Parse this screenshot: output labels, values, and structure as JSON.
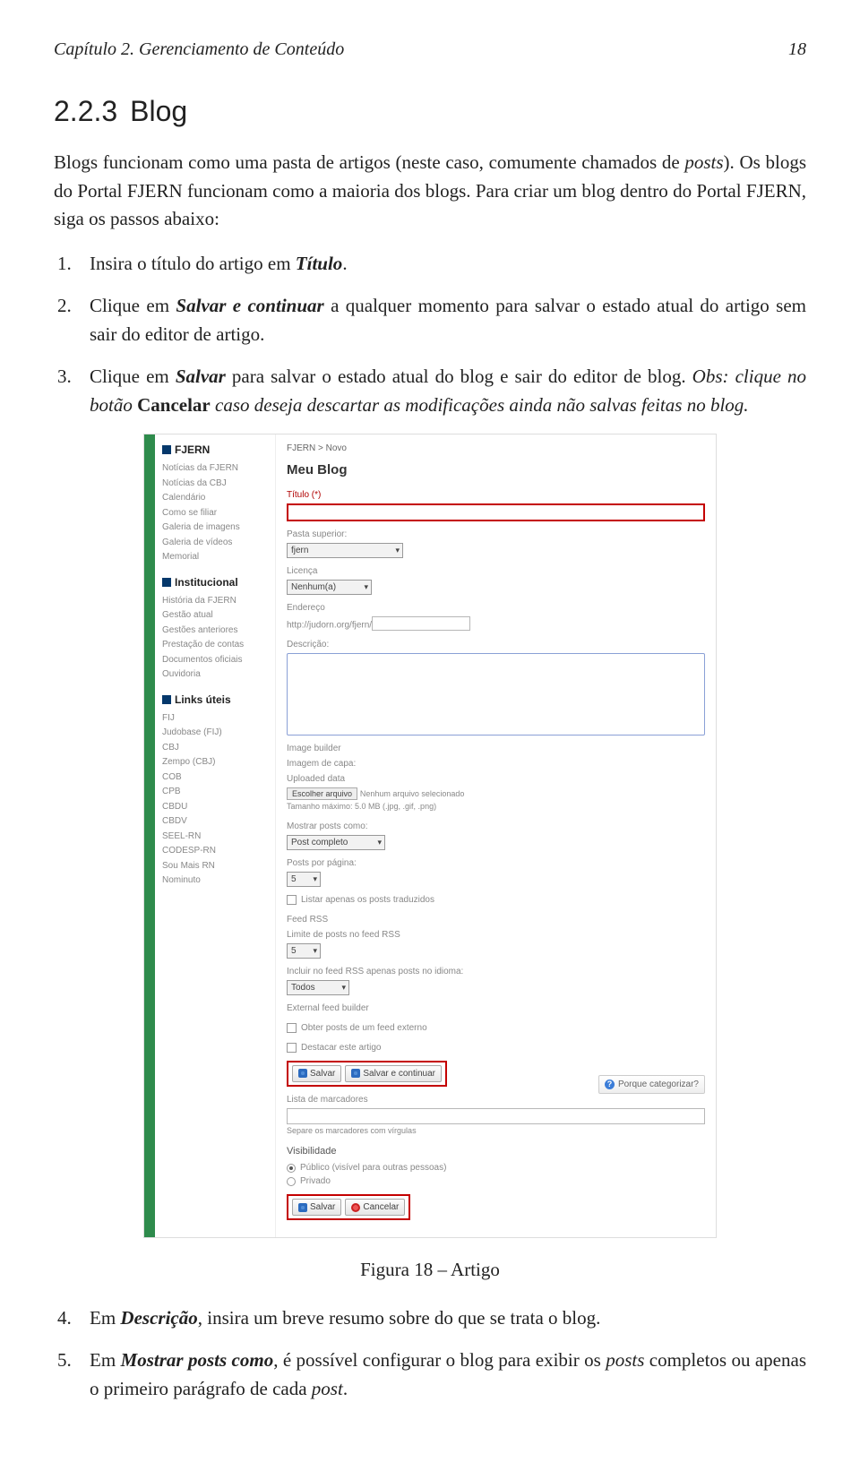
{
  "header": {
    "chapter": "Capítulo 2. Gerenciamento de Conteúdo",
    "page": "18"
  },
  "section": {
    "number": "2.2.3",
    "title": "Blog"
  },
  "intro_part1": "Blogs funcionam como uma pasta de artigos (neste caso, comumente chamados de ",
  "intro_posts": "posts",
  "intro_part2": "). Os blogs do Portal FJERN funcionam como a maioria dos blogs. Para criar um blog dentro do Portal FJERN, siga os passos abaixo:",
  "steps": {
    "s1_a": "Insira o título do artigo em ",
    "s1_b": "Título",
    "s1_c": ".",
    "s2_a": "Clique em ",
    "s2_b": "Salvar e continuar",
    "s2_c": " a qualquer momento para salvar o estado atual do artigo sem sair do editor de artigo.",
    "s3_a": "Clique em ",
    "s3_b": "Salvar",
    "s3_c": " para salvar o estado atual do blog e sair do editor de blog. ",
    "s3_d": "Obs: clique no botão ",
    "s3_e": "Cancelar",
    "s3_f": " caso deseja descartar as modificações ainda não salvas feitas no blog.",
    "s4_a": "Em ",
    "s4_b": "Descrição",
    "s4_c": ", insira um breve resumo sobre do que se trata o blog.",
    "s5_a": "Em ",
    "s5_b": "Mostrar posts como",
    "s5_c": ", é possível configurar o blog para exibir os ",
    "s5_d": "posts",
    "s5_e": " completos ou apenas o primeiro parágrafo de cada ",
    "s5_f": "post",
    "s5_g": "."
  },
  "figure_caption": "Figura 18 – Artigo",
  "screenshot": {
    "breadcrumb": "FJERN > Novo",
    "title": "Meu Blog",
    "sidebar": {
      "g1": {
        "title": "FJERN",
        "items": [
          "Notícias da FJERN",
          "Notícias da CBJ",
          "Calendário",
          "Como se filiar",
          "Galeria de imagens",
          "Galeria de vídeos",
          "Memorial"
        ]
      },
      "g2": {
        "title": "Institucional",
        "items": [
          "História da FJERN",
          "Gestão atual",
          "Gestões anteriores",
          "Prestação de contas",
          "Documentos oficiais",
          "Ouvidoria"
        ]
      },
      "g3": {
        "title": "Links úteis",
        "items": [
          "FIJ",
          "Judobase (FIJ)",
          "CBJ",
          "Zempo (CBJ)",
          "COB",
          "CPB",
          "CBDU",
          "CBDV",
          "SEEL-RN",
          "CODESP-RN",
          "Sou Mais RN",
          "Nominuto"
        ]
      }
    },
    "labels": {
      "titulo": "Título (*)",
      "pasta": "Pasta superior:",
      "pasta_val": "fjern",
      "licenca": "Licença",
      "licenca_val": "Nenhum(a)",
      "endereco": "Endereço",
      "endereco_val": "http://judorn.org/fjern/",
      "descricao": "Descrição:",
      "image_builder": "Image builder",
      "imagem_capa": "Imagem de capa:",
      "uploaded": "Uploaded data",
      "escolher": "Escolher arquivo",
      "nenhum_arquivo": "Nenhum arquivo selecionado",
      "tamanho": "Tamanho máximo: 5.0 MB (.jpg, .gif, .png)",
      "mostrar_posts": "Mostrar posts como:",
      "mostrar_val": "Post completo",
      "posts_pagina": "Posts por página:",
      "posts_pagina_val": "5",
      "listar_traduzidos": "Listar apenas os posts traduzidos",
      "feed_rss": "Feed RSS",
      "limite_feed": "Limite de posts no feed RSS",
      "limite_val": "5",
      "incluir_feed": "Incluir no feed RSS apenas posts no idioma:",
      "incluir_val": "Todos",
      "external_feed": "External feed builder",
      "obter_posts": "Obter posts de um feed externo",
      "destacar": "Destacar este artigo",
      "salvar": "Salvar",
      "salvar_continuar": "Salvar e continuar",
      "porque": "Porque categorizar?",
      "lista_marcadores": "Lista de marcadores",
      "separe": "Separe os marcadores com vírgulas",
      "visibilidade": "Visibilidade",
      "publico": "Público (visível para outras pessoas)",
      "privado": "Privado",
      "cancelar": "Cancelar"
    }
  }
}
